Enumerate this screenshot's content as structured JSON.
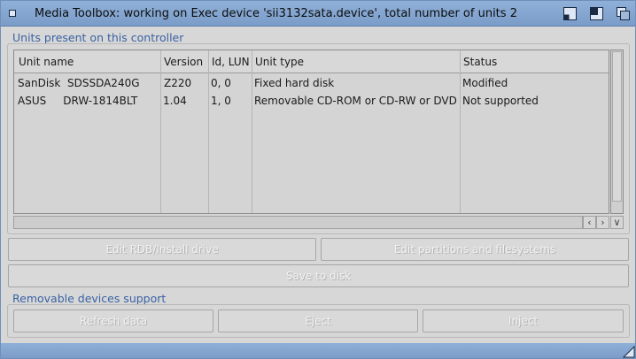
{
  "window": {
    "title": "Media Toolbox: working on Exec device 'sii3132sata.device', total number of units 2",
    "accent_color": "#7a9cc8"
  },
  "units_group": {
    "label": "Units present on this controller",
    "columns": [
      "Unit name",
      "Version",
      "Id, LUN",
      "Unit type",
      "Status"
    ],
    "rows": [
      {
        "name": "SanDisk  SDSSDA240G",
        "version": "Z220",
        "id_lun": "0, 0",
        "type": "Fixed hard disk",
        "status": "Modified"
      },
      {
        "name": "ASUS     DRW-1814BLT",
        "version": "1.04",
        "id_lun": "1, 0",
        "type": "Removable CD-ROM or CD-RW or DVD",
        "status": "Not supported"
      }
    ]
  },
  "buttons": {
    "edit_rdb": "Edit RDB/Install drive",
    "edit_partitions": "Edit partitions and filesystems",
    "save_to_disk": "Save to disk"
  },
  "removable_group": {
    "label": "Removable devices support",
    "refresh": "Refresh data",
    "eject": "Eject",
    "inject": "Inject"
  },
  "icons": {
    "close": "close-icon",
    "iconify": "iconify-icon",
    "zoom": "zoom-icon",
    "depth": "depth-icon",
    "scroll_left": "arrow-left-icon",
    "scroll_right": "arrow-right-icon",
    "scroll_down": "arrow-down-icon",
    "resize": "resize-grip-icon"
  }
}
